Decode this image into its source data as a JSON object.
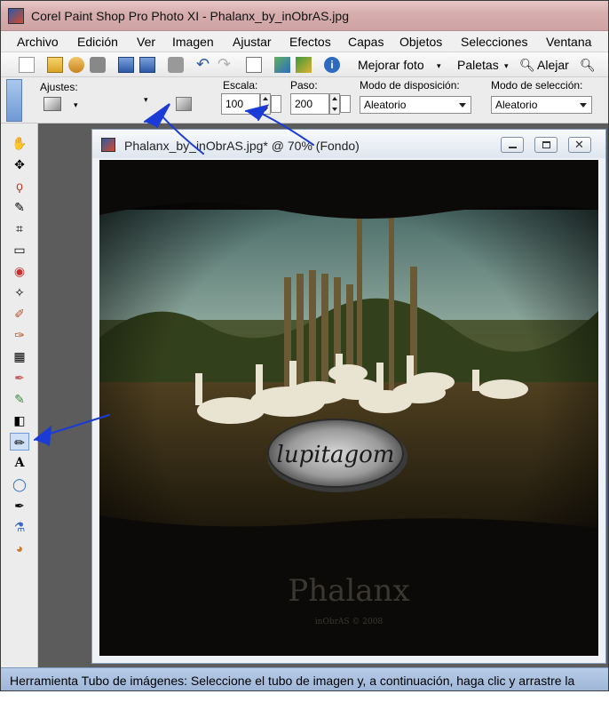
{
  "window": {
    "title": "Corel Paint Shop Pro Photo XI - Phalanx_by_inObrAS.jpg"
  },
  "menu": {
    "items": [
      {
        "label": "Archivo",
        "key": "A"
      },
      {
        "label": "Edición",
        "key": "E"
      },
      {
        "label": "Ver",
        "key": "V"
      },
      {
        "label": "Imagen",
        "key": "I"
      },
      {
        "label": "Ajustar",
        "key": "j"
      },
      {
        "label": "Efectos",
        "key": "f"
      },
      {
        "label": "Capas",
        "key": "p"
      },
      {
        "label": "Objetos",
        "key": "O"
      },
      {
        "label": "Selecciones",
        "key": "S"
      },
      {
        "label": "Ventana",
        "key": "V"
      }
    ]
  },
  "toolbar": {
    "enhance_label": "Mejorar foto",
    "palettes_label": "Paletas",
    "zoom_out_label": "Alejar"
  },
  "options": {
    "presets_label": "Ajustes:",
    "scale_label": "Escala:",
    "scale_value": "100",
    "step_label": "Paso:",
    "step_value": "200",
    "placement_label": "Modo de disposición:",
    "placement_value": "Aleatorio",
    "selection_label": "Modo de selección:",
    "selection_value": "Aleatorio"
  },
  "document": {
    "title": "Phalanx_by_inObrAS.jpg* @  70% (Fondo)",
    "watermark": "lupitagom",
    "image_title": "Phalanx",
    "image_credit": "inObrAS © 2008"
  },
  "status": {
    "text": "Herramienta Tubo de imágenes: Seleccione el tubo de imagen y, a continuación, haga clic y arrastre la"
  },
  "colors": {
    "annotation": "#1a3bd6"
  }
}
